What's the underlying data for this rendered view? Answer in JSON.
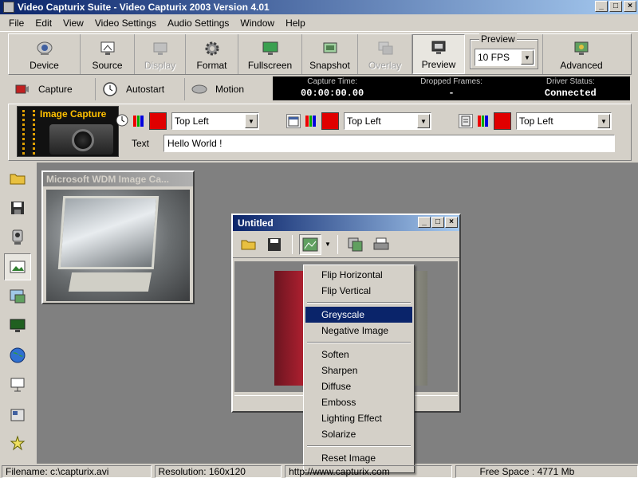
{
  "app": {
    "title": "Video Capturix Suite - Video Capturix 2003 Version 4.01",
    "window_buttons": [
      "_",
      "□",
      "×"
    ]
  },
  "menu": [
    "File",
    "Edit",
    "View",
    "Video Settings",
    "Audio Settings",
    "Window",
    "Help"
  ],
  "toolbar": {
    "device": "Device",
    "source": "Source",
    "display": "Display",
    "format": "Format",
    "fullscreen": "Fullscreen",
    "snapshot": "Snapshot",
    "overlay": "Overlay",
    "preview": "Preview",
    "preview_group_label": "Preview",
    "fps_value": "10 FPS",
    "advanced": "Advanced"
  },
  "toolbar2": {
    "capture": "Capture",
    "autostart": "Autostart",
    "motion": "Motion"
  },
  "status_panel": {
    "capture_time_label": "Capture Time:",
    "capture_time_value": "00:00:00.00",
    "dropped_frames_label": "Dropped Frames:",
    "dropped_frames_value": "-",
    "driver_status_label": "Driver Status:",
    "driver_status_value": "Connected"
  },
  "overlay": {
    "image_capture_title": "Image Capture",
    "position1": "Top Left",
    "position2": "Top Left",
    "position3": "Top Left",
    "swatch_color": "#e00000",
    "text_label": "Text",
    "text_value": "Hello World !"
  },
  "preview_window": {
    "title": "Microsoft WDM Image Ca..."
  },
  "child_window": {
    "title": "Untitled"
  },
  "context_menu": {
    "items": [
      {
        "label": "Flip Horizontal"
      },
      {
        "label": "Flip Vertical"
      },
      {
        "label": "Greyscale"
      },
      {
        "label": "Negative Image"
      },
      {
        "label": "Soften"
      },
      {
        "label": "Sharpen"
      },
      {
        "label": "Diffuse"
      },
      {
        "label": "Emboss"
      },
      {
        "label": "Lighting Effect"
      },
      {
        "label": "Solarize"
      },
      {
        "label": "Reset Image"
      }
    ],
    "selected": "Greyscale"
  },
  "statusbar": {
    "filename": "Filename: c:\\capturix.avi",
    "resolution": "Resolution: 160x120",
    "url": "http://www.capturix.com",
    "free_space": "Free Space : 4771 Mb"
  }
}
